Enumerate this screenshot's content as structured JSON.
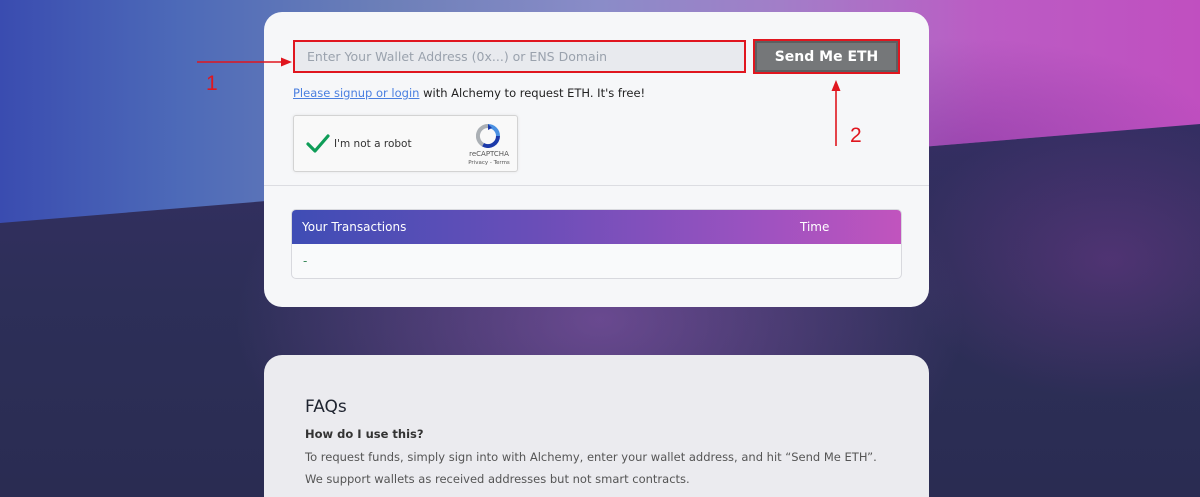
{
  "form": {
    "wallet_placeholder": "Enter Your Wallet Address (0x...) or ENS Domain",
    "send_label": "Send Me ETH",
    "signup_link": "Please signup or login",
    "signup_rest": " with Alchemy to request ETH. It's free!"
  },
  "captcha": {
    "label": "I'm not a robot",
    "brand": "reCAPTCHA",
    "terms": "Privacy - Terms",
    "check_icon": "checkmark-icon",
    "logo_icon": "recaptcha-logo-icon"
  },
  "transactions": {
    "col_transactions": "Your Transactions",
    "col_time": "Time",
    "empty_value": "-"
  },
  "faq": {
    "title": "FAQs",
    "question": "How do I use this?",
    "answer": "To request funds, simply sign into with Alchemy, enter your wallet address, and hit “Send Me ETH”. We support wallets as received addresses but not smart contracts."
  },
  "annotations": {
    "marker_1": "1",
    "marker_2": "2",
    "color": "#e0161f"
  },
  "colors": {
    "accent_red": "#e0161f",
    "button_gray": "#757779",
    "link_blue": "#4a7fe0",
    "header_gradient_start": "#3f4db5",
    "header_gradient_end": "#c154be"
  }
}
